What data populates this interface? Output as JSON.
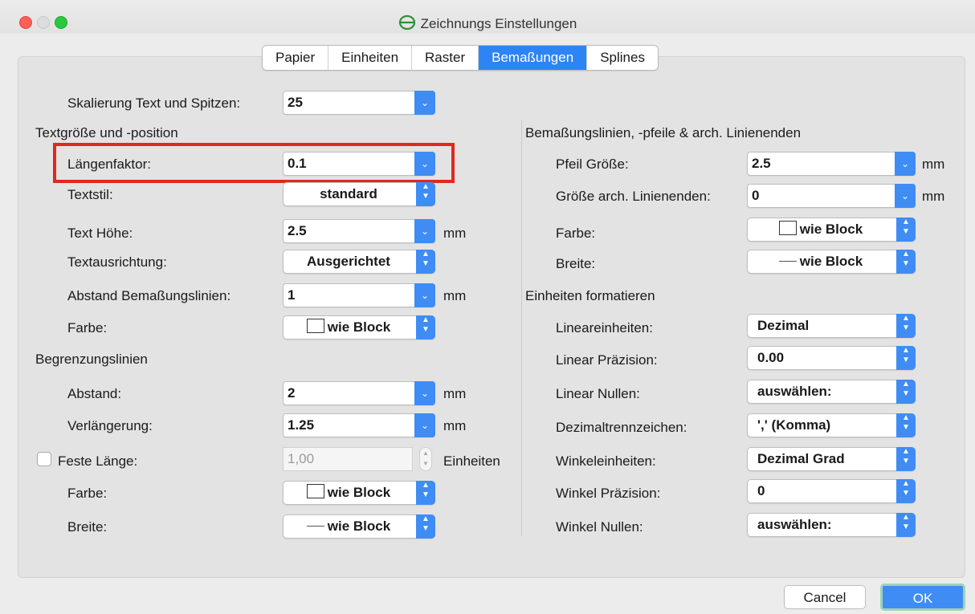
{
  "window": {
    "title": "Zeichnungs Einstellungen"
  },
  "tabs": [
    {
      "label": "Papier",
      "active": false
    },
    {
      "label": "Einheiten",
      "active": false
    },
    {
      "label": "Raster",
      "active": false
    },
    {
      "label": "Bemaßungen",
      "active": true
    },
    {
      "label": "Splines",
      "active": false
    }
  ],
  "left": {
    "scale": {
      "label": "Skalierung Text und Spitzen:",
      "value": "25"
    },
    "text_section": {
      "title": "Textgröße und -position",
      "length_factor": {
        "label": "Längenfaktor:",
        "value": "0.1"
      },
      "text_style": {
        "label": "Textstil:",
        "value": "standard"
      },
      "text_height": {
        "label": "Text Höhe:",
        "value": "2.5",
        "unit": "mm"
      },
      "alignment": {
        "label": "Textausrichtung:",
        "value": "Ausgerichtet"
      },
      "dim_line_gap": {
        "label": "Abstand Bemaßungslinien:",
        "value": "1",
        "unit": "mm"
      },
      "color": {
        "label": "Farbe:",
        "value": "wie Block"
      }
    },
    "ext_section": {
      "title": "Begrenzungslinien",
      "gap": {
        "label": "Abstand:",
        "value": "2",
        "unit": "mm"
      },
      "extension": {
        "label": "Verlängerung:",
        "value": "1.25",
        "unit": "mm"
      },
      "fixed_length": {
        "label": "Feste Länge:",
        "value": "1,00",
        "unit": "Einheiten"
      },
      "color": {
        "label": "Farbe:",
        "value": "wie Block"
      },
      "width": {
        "label": "Breite:",
        "value": "wie Block"
      }
    }
  },
  "right": {
    "arrow_section": {
      "title": "Bemaßungslinien, -pfeile & arch. Linienenden",
      "arrow_size": {
        "label": "Pfeil Größe:",
        "value": "2.5",
        "unit": "mm"
      },
      "arch_size": {
        "label": "Größe arch. Linienenden:",
        "value": "0",
        "unit": "mm"
      },
      "color": {
        "label": "Farbe:",
        "value": "wie Block"
      },
      "width": {
        "label": "Breite:",
        "value": "wie Block"
      }
    },
    "format_section": {
      "title": "Einheiten formatieren",
      "linear_units": {
        "label": "Lineareinheiten:",
        "value": "Dezimal"
      },
      "linear_precision": {
        "label": "Linear Präzision:",
        "value": "0.00"
      },
      "linear_zeros": {
        "label": "Linear Nullen:",
        "value": "auswählen:"
      },
      "decimal_sep": {
        "label": "Dezimaltrennzeichen:",
        "value": "',' (Komma)"
      },
      "angle_units": {
        "label": "Winkeleinheiten:",
        "value": "Dezimal Grad"
      },
      "angle_precision": {
        "label": "Winkel Präzision:",
        "value": "0"
      },
      "angle_zeros": {
        "label": "Winkel Nullen:",
        "value": "auswählen:"
      }
    }
  },
  "buttons": {
    "cancel": "Cancel",
    "ok": "OK"
  },
  "colors": {
    "accent": "#3f8cf5",
    "highlight": "#e0281f"
  }
}
